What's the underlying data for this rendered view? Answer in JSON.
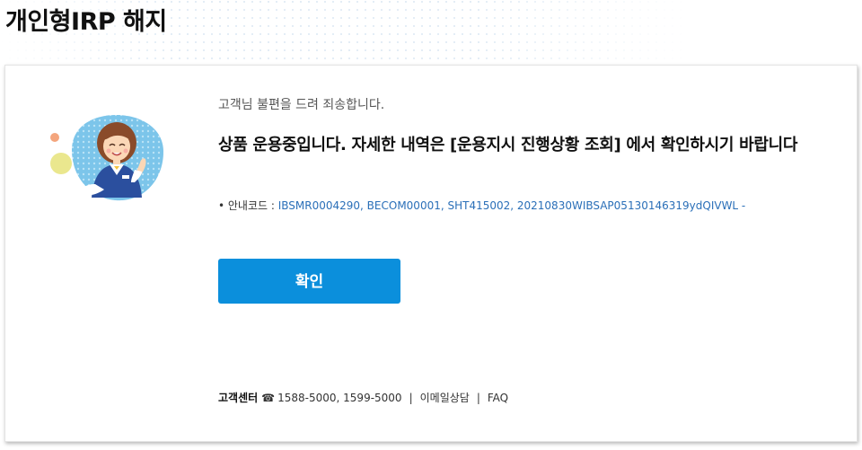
{
  "page": {
    "title": "개인형IRP 해지"
  },
  "notice": {
    "apology": "고객님 불편을 드려 죄송합니다.",
    "message": "상품 운용중입니다. 자세한 내역은 [운용지시 진행상황 조회] 에서 확인하시기 바랍니다",
    "code_label": "• 안내코드 : ",
    "code_value": "IBSMR0004290, BECOM00001, SHT415002, 20210830WIBSAP05130146319ydQIVWL -",
    "confirm_label": "확인"
  },
  "footer": {
    "center_label": "고객센터",
    "phone_icon": "phone-icon",
    "phone_numbers": "1588-5000, 1599-5000",
    "separator": "|",
    "email_label": "이메일상담",
    "faq_label": "FAQ"
  },
  "colors": {
    "accent": "#0b8fdc",
    "code_text": "#2a6fb8"
  }
}
